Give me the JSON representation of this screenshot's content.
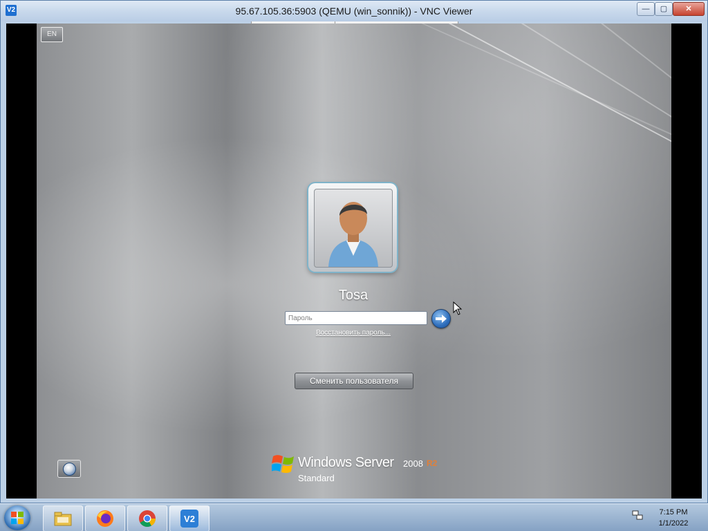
{
  "window": {
    "title": "95.67.105.36:5903 (QEMU (win_sonnik)) - VNC Viewer",
    "app_icon_label": "V2",
    "controls": {
      "minimize": "—",
      "maximize": "▢",
      "close": "✕"
    }
  },
  "login": {
    "language": "EN",
    "username": "Tosa",
    "password_placeholder": "Пароль",
    "reset_password_link": "Восстановить пароль...",
    "switch_user_button": "Сменить пользователя",
    "brand_name": "Windows Server",
    "brand_version": "2008",
    "brand_release": "R2",
    "brand_edition": "Standard"
  },
  "taskbar": {
    "items": [
      {
        "name": "file-explorer-icon"
      },
      {
        "name": "firefox-icon"
      },
      {
        "name": "chrome-icon"
      },
      {
        "name": "vnc-viewer-icon",
        "label": "V2"
      }
    ],
    "clock": {
      "time": "7:15 PM",
      "date": "1/1/2022"
    }
  },
  "colors": {
    "title_bar": "#c9d9ec",
    "close_button": "#c6432f",
    "login_background": "#9a9c9f",
    "brand_r2": "#e0803a"
  }
}
